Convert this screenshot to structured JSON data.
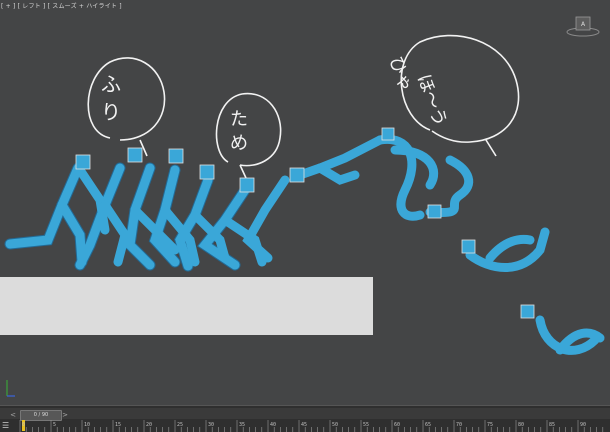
{
  "viewport": {
    "label": "[ + ] [ レフト ] [ スムーズ + ハイライト ]",
    "viewcube_icon": "viewcube-icon",
    "background": "#444546"
  },
  "annotations": {
    "bubble_1": "ふり",
    "bubble_2": "ため",
    "bubble_3_line1": "ひゃ",
    "bubble_3_line2": "ほ〜う"
  },
  "colors": {
    "figure": "#3aa7d8",
    "figure_shadow": "#1f6f9f",
    "ground_box": "#dcdcdc",
    "keyframe": "#e8c020"
  },
  "timeline": {
    "slider_text": "0 / 90",
    "prev_arrow": "<",
    "next_arrow": ">",
    "ticks": [
      "0",
      "5",
      "10",
      "15",
      "20",
      "25",
      "30",
      "35",
      "40",
      "45",
      "50",
      "55",
      "60",
      "65",
      "70",
      "75",
      "80",
      "85",
      "90"
    ]
  }
}
